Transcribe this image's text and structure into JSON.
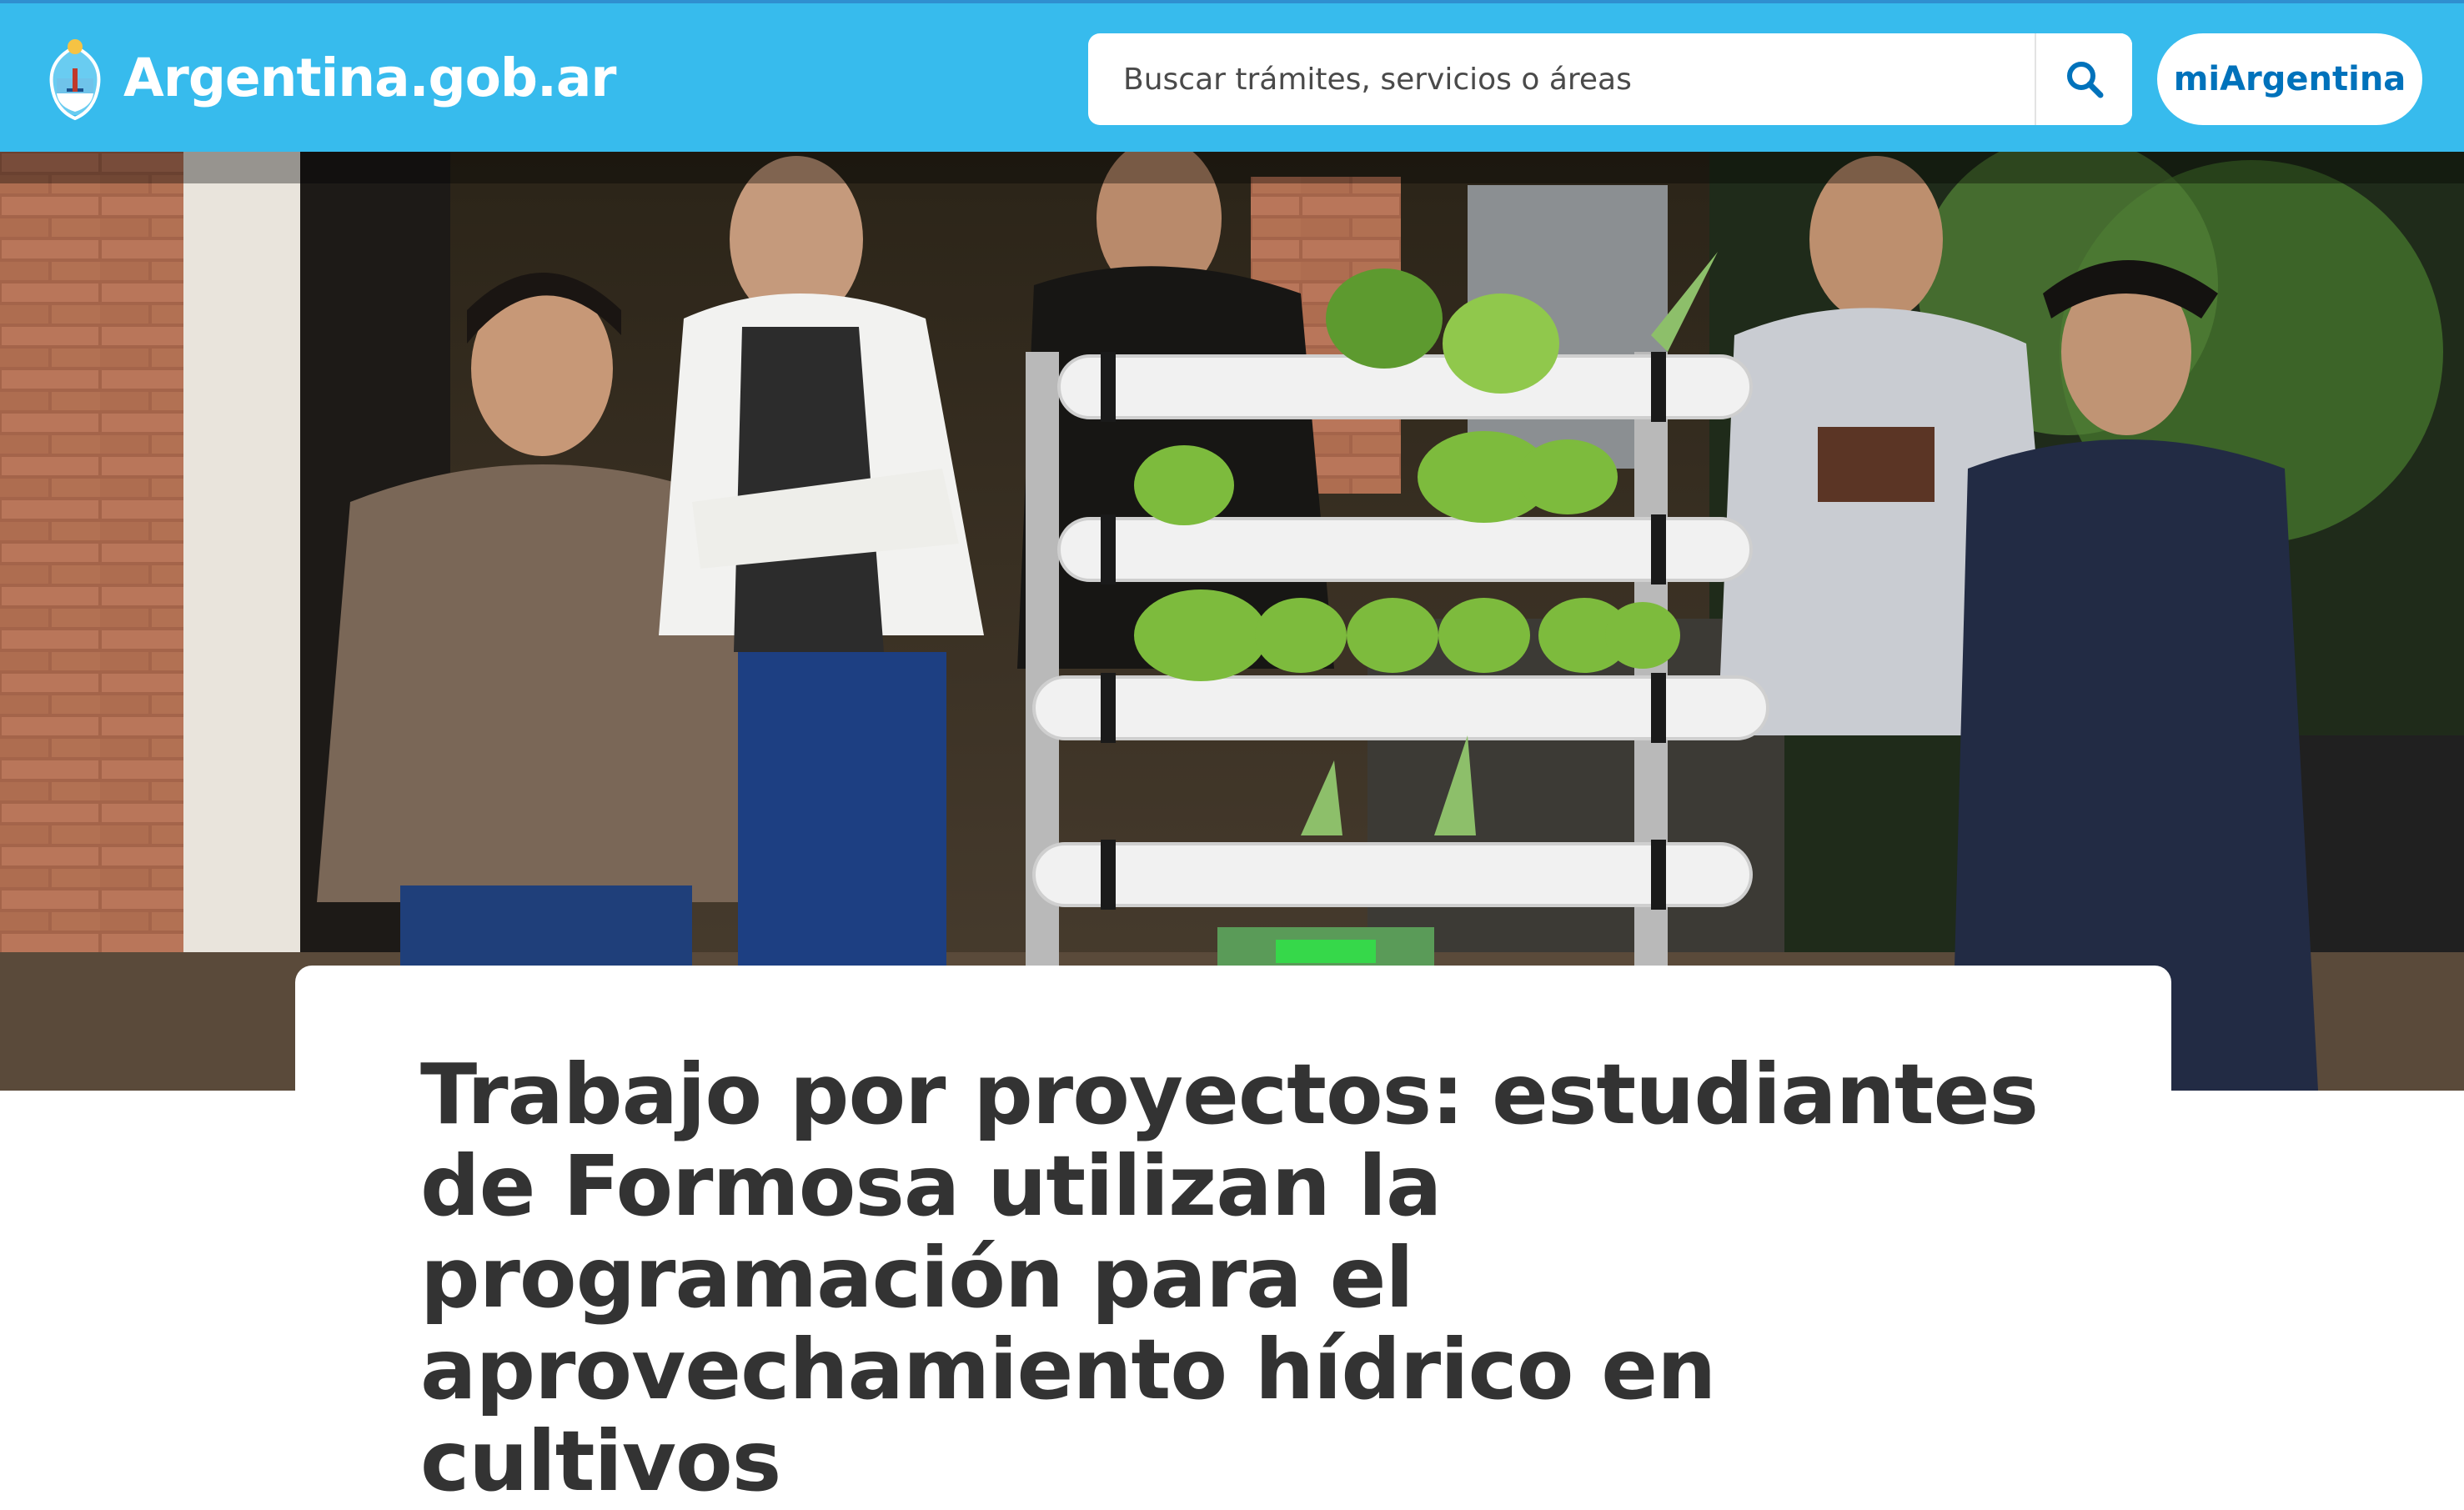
{
  "header": {
    "brand_name": "Argentina.gob.ar",
    "logo_icon": "escudo-nacional-icon",
    "search": {
      "placeholder": "Buscar trámites, servicios o áreas",
      "button_icon": "search-icon"
    },
    "account_button_label": "miArgentina"
  },
  "hero": {
    "image_subject": "Estudiantes junto a un sistema de cultivo hidropónico"
  },
  "article": {
    "title": "Trabajo por proyectos: estudiantes de Formosa utilizan la programación para el aprovechamiento hídrico en cultivos"
  },
  "colors": {
    "header_bg": "#37bbed",
    "header_border": "#2f8fd0",
    "accent": "#0072bb",
    "title_text": "#333333"
  }
}
